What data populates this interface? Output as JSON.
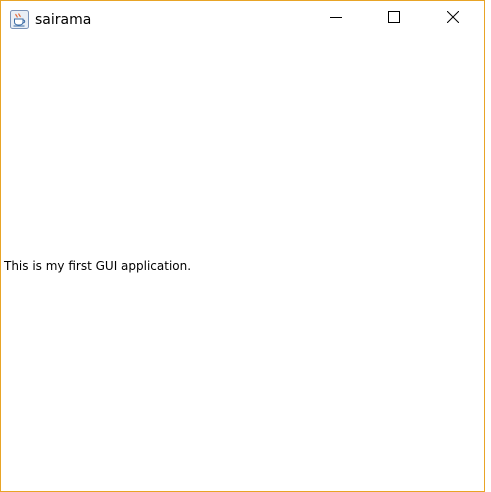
{
  "window": {
    "title": "sairama",
    "app_icon": "java-coffee-cup-icon",
    "border_color": "#e8a426",
    "controls": {
      "minimize_icon": "minimize-icon",
      "maximize_icon": "maximize-icon",
      "close_icon": "close-icon"
    }
  },
  "content": {
    "label_text": "This is my first GUI application."
  }
}
